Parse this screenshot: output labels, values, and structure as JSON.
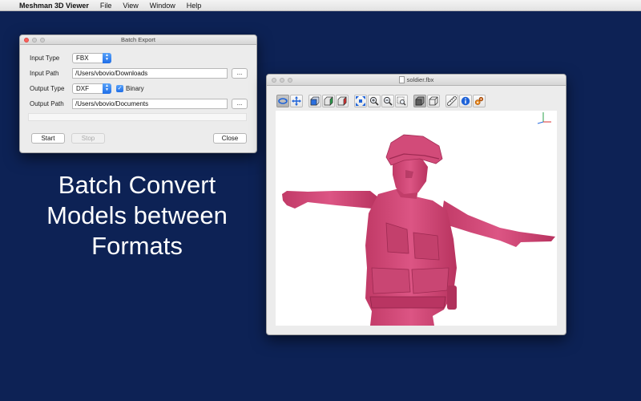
{
  "menubar": {
    "apple_glyph": "",
    "app_name": "Meshman 3D Viewer",
    "items": [
      "File",
      "View",
      "Window",
      "Help"
    ]
  },
  "batch_export": {
    "title": "Batch Export",
    "input_type_label": "Input Type",
    "input_type_value": "FBX",
    "input_path_label": "Input Path",
    "input_path_value": "/Users/vbovio/Downloads",
    "output_type_label": "Output Type",
    "output_type_value": "DXF",
    "binary_label": "Binary",
    "binary_checked": true,
    "output_path_label": "Output Path",
    "output_path_value": "/Users/vbovio/Documents",
    "browse_label": "...",
    "progress": 0,
    "start_label": "Start",
    "stop_label": "Stop",
    "close_label": "Close"
  },
  "hero": {
    "line1": "Batch Convert",
    "line2": "Models between",
    "line3": "Formats"
  },
  "viewer": {
    "title": "soldier.fbx",
    "model_color": "#d24b79",
    "toolbar": [
      "rotate-tool-icon",
      "pan-tool-icon",
      "view-front-icon",
      "view-side-icon",
      "view-top-icon",
      "fit-view-icon",
      "zoom-in-icon",
      "zoom-out-icon",
      "zoom-region-icon",
      "solid-shading-icon",
      "wireframe-shading-icon",
      "measure-icon",
      "info-icon",
      "settings-gears-icon"
    ]
  },
  "colors": {
    "desktop": "#0d2255",
    "accent": "#2a7cf0"
  }
}
